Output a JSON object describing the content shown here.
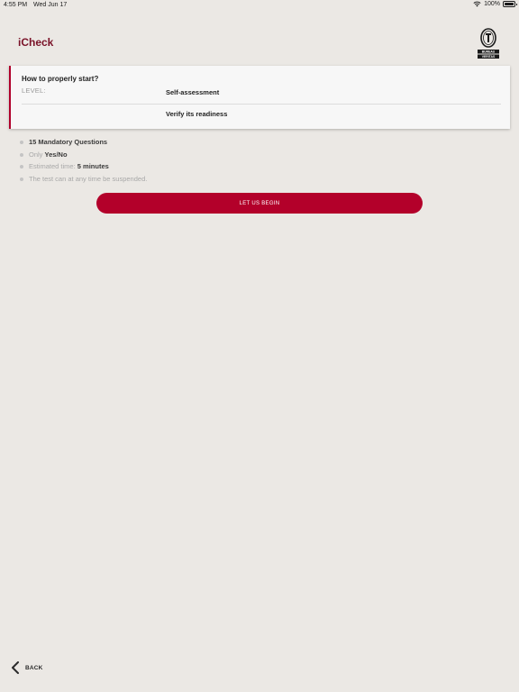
{
  "status_bar": {
    "time": "4:55 PM",
    "date": "Wed Jun 17",
    "battery": "100%",
    "battery_level": 1.0
  },
  "header": {
    "title": "iCheck",
    "logo_icon": "bureau-veritas-logo-icon",
    "logo_text": [
      "BUREAU",
      "VERITAS"
    ]
  },
  "card": {
    "title": "How to properly start?",
    "level_label": "LEVEL:",
    "level_value": "Self-assessment",
    "subtitle": "Verify its readiness"
  },
  "info": {
    "questions_bold": "15 Mandatory Questions",
    "only_prefix": "Only",
    "only_bold": "Yes/No",
    "time_prefix": "Estimated time:",
    "time_bold": "5 minutes",
    "suspend_note": "The test can at any time be suspended."
  },
  "actions": {
    "begin_label": "LET US BEGIN",
    "back_label": "BACK"
  },
  "colors": {
    "accent": "#b3002a",
    "title": "#7a1228",
    "background": "#ebe8e4"
  }
}
